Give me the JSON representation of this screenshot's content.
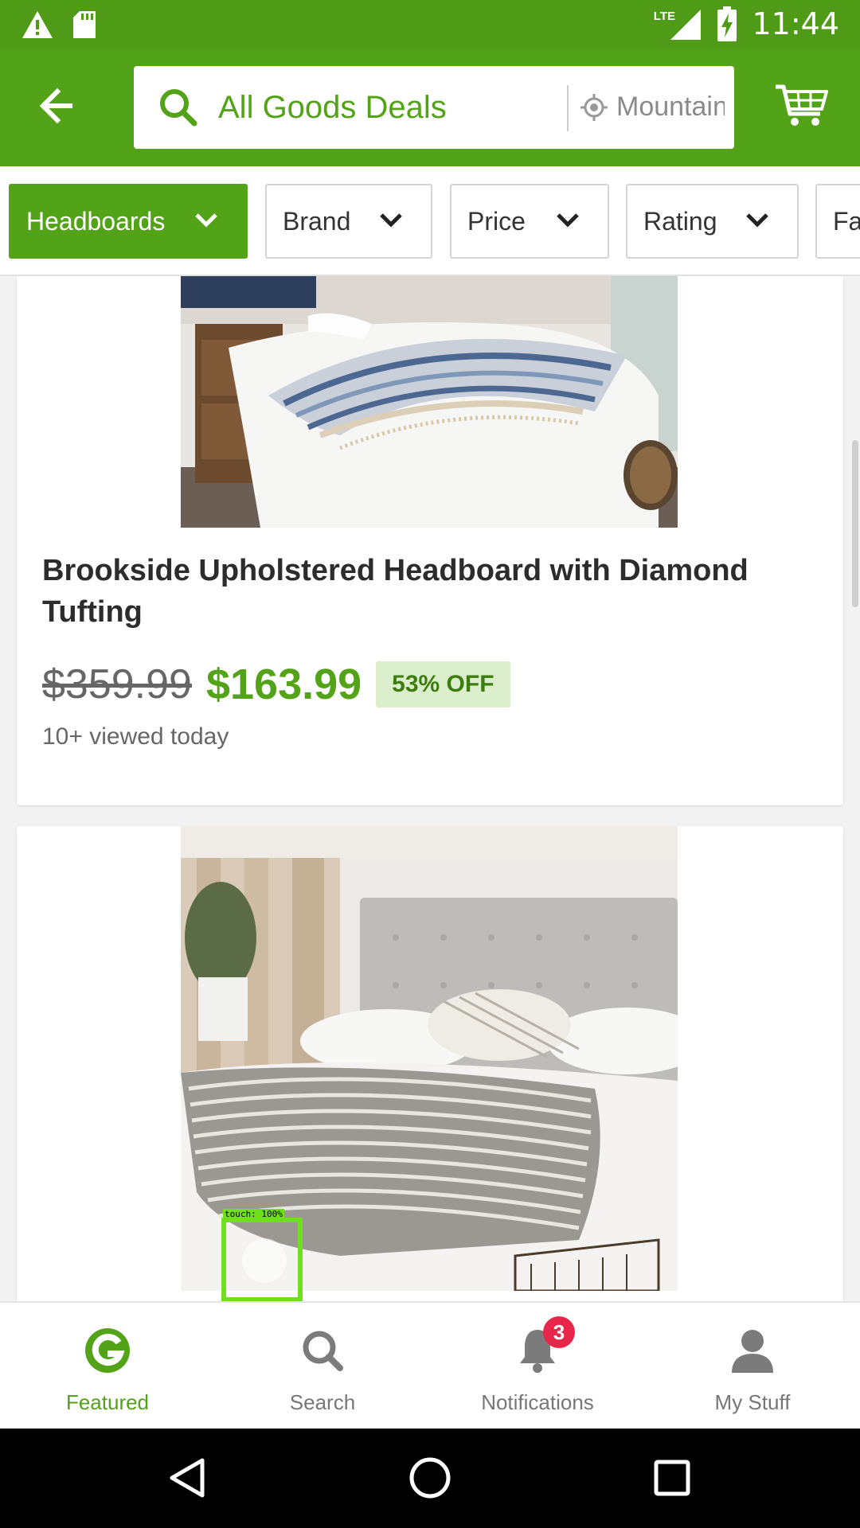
{
  "status_bar": {
    "time": "11:44",
    "network": "LTE",
    "icons": [
      "alert-icon",
      "sd-card-icon",
      "signal-icon",
      "battery-charging-icon"
    ]
  },
  "header": {
    "search_query": "All Goods Deals",
    "location": "Mountain View",
    "icons": [
      "back-arrow-icon",
      "search-icon",
      "location-icon",
      "cart-icon"
    ]
  },
  "filters": [
    {
      "label": "Headboards",
      "active": true
    },
    {
      "label": "Brand",
      "active": false
    },
    {
      "label": "Price",
      "active": false
    },
    {
      "label": "Rating",
      "active": false
    },
    {
      "label": "Fa",
      "active": false
    }
  ],
  "products": [
    {
      "title": "Brookside Upholstered Headboard with Diamond Tufting",
      "original_price": "$359.99",
      "sale_price": "$163.99",
      "discount": "53% OFF",
      "viewed": "10+ viewed today"
    },
    {
      "title": "",
      "image": "gray-tufted-headboard-bed"
    }
  ],
  "touch_indicator": {
    "label": "touch: 100%"
  },
  "bottom_nav": {
    "items": [
      {
        "label": "Featured",
        "icon": "groupon-g-icon",
        "active": true
      },
      {
        "label": "Search",
        "icon": "search-icon",
        "active": false
      },
      {
        "label": "Notifications",
        "icon": "bell-icon",
        "active": false,
        "badge": "3"
      },
      {
        "label": "My Stuff",
        "icon": "person-icon",
        "active": false
      }
    ]
  },
  "colors": {
    "brand_green": "#53a318",
    "status_green": "#4f9a16",
    "badge_red": "#e8264a",
    "discount_bg": "#dbefcd"
  }
}
